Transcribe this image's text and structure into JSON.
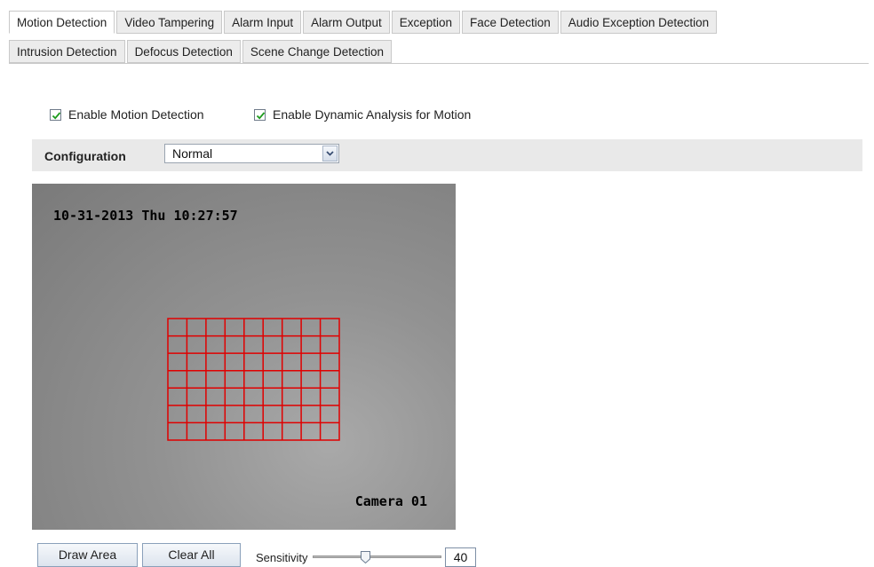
{
  "tabs": {
    "row1": [
      "Motion Detection",
      "Video Tampering",
      "Alarm Input",
      "Alarm Output",
      "Exception",
      "Face Detection",
      "Audio Exception Detection"
    ],
    "row2": [
      "Intrusion Detection",
      "Defocus Detection",
      "Scene Change Detection"
    ],
    "active": "Motion Detection"
  },
  "options": {
    "enable_motion": {
      "label": "Enable Motion Detection",
      "checked": true
    },
    "enable_dynamic": {
      "label": "Enable Dynamic Analysis for Motion",
      "checked": true
    }
  },
  "configuration": {
    "label": "Configuration",
    "value": "Normal"
  },
  "video": {
    "timestamp": "10-31-2013 Thu 10:27:57",
    "camera_name": "Camera 01"
  },
  "actions": {
    "draw_area": "Draw Area",
    "clear_all": "Clear All"
  },
  "sensitivity": {
    "label": "Sensitivity",
    "value": "40",
    "level_fraction": 0.4
  },
  "colors": {
    "grid": "#e00000",
    "check": "#1b9a1b",
    "configbar": "#e9e9e9"
  },
  "icons": {
    "checkbox": "check-icon",
    "select": "chevron-down-icon"
  }
}
